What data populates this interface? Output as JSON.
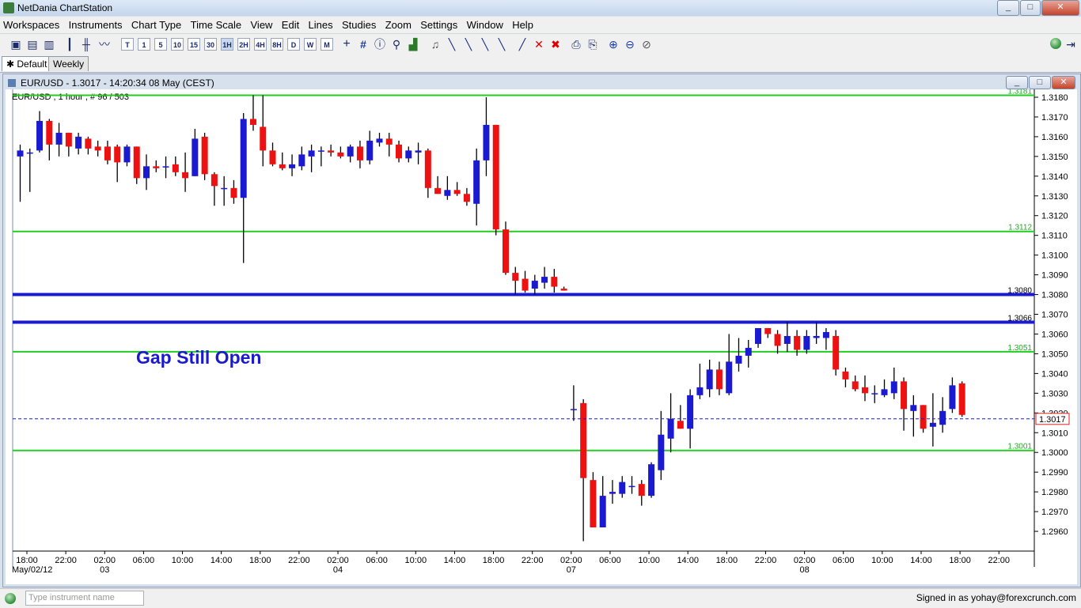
{
  "window": {
    "title": "NetDania ChartStation",
    "controls": [
      "_",
      "□",
      "✕"
    ]
  },
  "menu": [
    "Workspaces",
    "Instruments",
    "Chart Type",
    "Time Scale",
    "View",
    "Edit",
    "Lines",
    "Studies",
    "Zoom",
    "Settings",
    "Window",
    "Help"
  ],
  "toolbar": {
    "timescales": [
      "T",
      "1",
      "5",
      "10",
      "15",
      "30",
      "1H",
      "2H",
      "4H",
      "8H",
      "D",
      "W",
      "M"
    ],
    "icons": [
      "new-icon",
      "open-icon",
      "save-icon",
      "candles-icon",
      "bars-icon",
      "line-icon",
      "crosshair-icon",
      "grid-icon",
      "info-icon",
      "studies-icon",
      "alert-icon",
      "draw-tools-icon",
      "delete-icon",
      "delete-all-icon",
      "print-icon",
      "print-preview-icon",
      "zoom-in-icon",
      "zoom-out-icon",
      "zoom-reset-icon",
      "connection-icon",
      "pin-icon"
    ]
  },
  "tabs": [
    {
      "label": "Default",
      "active": true
    },
    {
      "label": "Weekly",
      "active": false
    }
  ],
  "chart_window": {
    "title": "EUR/USD - 1.3017 - 14:20:34  08 May (CEST)",
    "controls": [
      "_",
      "□",
      "✕"
    ]
  },
  "chart_data": {
    "type": "candlestick",
    "instrument_label": "EUR/USD , 1 hour , # 96 / 503",
    "annotation": "Gap Still Open",
    "ylim": [
      1.295,
      1.3184
    ],
    "y_ticks": [
      "1.2960",
      "1.2970",
      "1.2980",
      "1.2990",
      "1.3000",
      "1.3010",
      "1.3020",
      "1.3030",
      "1.3040",
      "1.3050",
      "1.3060",
      "1.3070",
      "1.3080",
      "1.3090",
      "1.3100",
      "1.3110",
      "1.3120",
      "1.3130",
      "1.3140",
      "1.3150",
      "1.3160",
      "1.3170",
      "1.3180"
    ],
    "x_ticks": [
      {
        "label": "18:00",
        "date": "May/02/12"
      },
      {
        "label": "22:00",
        "date": ""
      },
      {
        "label": "02:00",
        "date": "03"
      },
      {
        "label": "06:00",
        "date": ""
      },
      {
        "label": "10:00",
        "date": ""
      },
      {
        "label": "14:00",
        "date": ""
      },
      {
        "label": "18:00",
        "date": ""
      },
      {
        "label": "22:00",
        "date": ""
      },
      {
        "label": "02:00",
        "date": "04"
      },
      {
        "label": "06:00",
        "date": ""
      },
      {
        "label": "10:00",
        "date": ""
      },
      {
        "label": "14:00",
        "date": ""
      },
      {
        "label": "18:00",
        "date": ""
      },
      {
        "label": "22:00",
        "date": ""
      },
      {
        "label": "02:00",
        "date": "07"
      },
      {
        "label": "06:00",
        "date": ""
      },
      {
        "label": "10:00",
        "date": ""
      },
      {
        "label": "14:00",
        "date": ""
      },
      {
        "label": "18:00",
        "date": ""
      },
      {
        "label": "22:00",
        "date": ""
      },
      {
        "label": "02:00",
        "date": "08"
      },
      {
        "label": "06:00",
        "date": ""
      },
      {
        "label": "10:00",
        "date": ""
      },
      {
        "label": "14:00",
        "date": ""
      },
      {
        "label": "18:00",
        "date": ""
      },
      {
        "label": "22:00",
        "date": ""
      }
    ],
    "current_price": "1.3017",
    "levels": [
      {
        "label": "1.3181",
        "value": 1.3181,
        "color": "#22cc22",
        "type": "green"
      },
      {
        "label": "1.3112",
        "value": 1.3112,
        "color": "#22cc22",
        "type": "green"
      },
      {
        "label": "1.3080",
        "value": 1.308,
        "color": "#1a1ad0",
        "type": "blue"
      },
      {
        "label": "1.3066",
        "value": 1.3066,
        "color": "#1a1ad0",
        "type": "blue"
      },
      {
        "label": "1.3051",
        "value": 1.3051,
        "color": "#22cc22",
        "type": "green"
      },
      {
        "label": "1.3001",
        "value": 1.3001,
        "color": "#22cc22",
        "type": "green"
      }
    ],
    "colors": {
      "up": "#1a1ad0",
      "down": "#ee1111",
      "wick": "#000000",
      "current": "#1a1ad0",
      "annotation": "#1a1ad0"
    },
    "segments": [
      {
        "start_slot": 0,
        "candles": [
          [
            1.315,
            1.3156,
            1.3127,
            1.3153
          ],
          [
            1.3152,
            1.3154,
            1.3132,
            1.3152
          ],
          [
            1.3153,
            1.3173,
            1.3152,
            1.3168
          ],
          [
            1.3168,
            1.3169,
            1.3148,
            1.3156
          ],
          [
            1.3156,
            1.3167,
            1.315,
            1.3162
          ],
          [
            1.3162,
            1.3162,
            1.315,
            1.3155
          ],
          [
            1.3154,
            1.3162,
            1.3151,
            1.316
          ],
          [
            1.3159,
            1.316,
            1.3151,
            1.3154
          ],
          [
            1.3155,
            1.3158,
            1.315,
            1.3153
          ],
          [
            1.3155,
            1.3158,
            1.3146,
            1.3148
          ],
          [
            1.3155,
            1.3156,
            1.3137,
            1.3147
          ],
          [
            1.3147,
            1.3156,
            1.3145,
            1.3155
          ],
          [
            1.3155,
            1.3155,
            1.3136,
            1.3139
          ],
          [
            1.3139,
            1.3151,
            1.3133,
            1.3145
          ],
          [
            1.3145,
            1.3148,
            1.3142,
            1.3144
          ],
          [
            1.3145,
            1.315,
            1.3139,
            1.3145
          ],
          [
            1.3146,
            1.315,
            1.314,
            1.3142
          ],
          [
            1.3142,
            1.3152,
            1.3132,
            1.3139
          ],
          [
            1.314,
            1.3164,
            1.314,
            1.3159
          ],
          [
            1.316,
            1.3162,
            1.3138,
            1.3141
          ],
          [
            1.3141,
            1.3142,
            1.3125,
            1.3135
          ],
          [
            1.3134,
            1.314,
            1.3125,
            1.3134
          ],
          [
            1.3134,
            1.3138,
            1.3126,
            1.3129
          ],
          [
            1.3129,
            1.3172,
            1.3096,
            1.3169
          ],
          [
            1.3169,
            1.3181,
            1.3163,
            1.3166
          ],
          [
            1.3165,
            1.3181,
            1.3145,
            1.3153
          ],
          [
            1.3153,
            1.3157,
            1.3145,
            1.3146
          ],
          [
            1.3146,
            1.3152,
            1.3143,
            1.3144
          ],
          [
            1.3144,
            1.3151,
            1.314,
            1.3146
          ],
          [
            1.3145,
            1.3155,
            1.3143,
            1.3151
          ],
          [
            1.315,
            1.3156,
            1.3142,
            1.3153
          ],
          [
            1.3153,
            1.3155,
            1.3145,
            1.3153
          ],
          [
            1.3153,
            1.3156,
            1.315,
            1.3152
          ],
          [
            1.3152,
            1.3155,
            1.3149,
            1.315
          ],
          [
            1.315,
            1.3156,
            1.3147,
            1.3155
          ],
          [
            1.3155,
            1.3158,
            1.3144,
            1.3148
          ],
          [
            1.3148,
            1.3163,
            1.3146,
            1.3158
          ],
          [
            1.3157,
            1.3162,
            1.3155,
            1.3159
          ],
          [
            1.3159,
            1.3162,
            1.315,
            1.3156
          ],
          [
            1.3156,
            1.3158,
            1.3147,
            1.3149
          ],
          [
            1.3149,
            1.3155,
            1.3147,
            1.3153
          ],
          [
            1.3152,
            1.3157,
            1.3146,
            1.3153
          ],
          [
            1.3153,
            1.3154,
            1.3129,
            1.3134
          ],
          [
            1.3134,
            1.314,
            1.3131,
            1.3131
          ],
          [
            1.313,
            1.314,
            1.3128,
            1.3133
          ],
          [
            1.3133,
            1.3137,
            1.313,
            1.3131
          ],
          [
            1.3131,
            1.3134,
            1.3125,
            1.3127
          ],
          [
            1.3126,
            1.3154,
            1.3115,
            1.3148
          ],
          [
            1.3148,
            1.318,
            1.314,
            1.3166
          ],
          [
            1.3166,
            1.3166,
            1.311,
            1.3113
          ],
          [
            1.3113,
            1.3117,
            1.309,
            1.3091
          ],
          [
            1.3091,
            1.3094,
            1.308,
            1.3087
          ],
          [
            1.3088,
            1.3092,
            1.3081,
            1.3082
          ],
          [
            1.3083,
            1.309,
            1.308,
            1.3087
          ],
          [
            1.3086,
            1.3094,
            1.3083,
            1.3089
          ],
          [
            1.3089,
            1.3093,
            1.3081,
            1.3084
          ],
          [
            1.3083,
            1.3084,
            1.3082,
            1.3082
          ]
        ]
      },
      {
        "start_slot": 57,
        "candles": [
          [
            1.3022,
            1.3034,
            1.3016,
            1.3022
          ]
        ]
      },
      {
        "start_slot": 58,
        "candles": [
          [
            1.3025,
            1.3027,
            1.2955,
            1.2987
          ],
          [
            1.2986,
            1.299,
            1.2962,
            1.2962
          ],
          [
            1.2962,
            1.2988,
            1.2962,
            1.2978
          ],
          [
            1.2979,
            1.2986,
            1.2974,
            1.298
          ],
          [
            1.2979,
            1.2988,
            1.2977,
            1.2985
          ],
          [
            1.2983,
            1.2988,
            1.2979,
            1.2983
          ],
          [
            1.2984,
            1.2986,
            1.2973,
            1.2978
          ],
          [
            1.2978,
            1.2995,
            1.2977,
            1.2994
          ],
          [
            1.2991,
            1.3021,
            1.2986,
            1.3009
          ],
          [
            1.3007,
            1.303,
            1.3,
            1.3017
          ],
          [
            1.3016,
            1.3024,
            1.3012,
            1.3012
          ],
          [
            1.3012,
            1.3032,
            1.3002,
            1.3029
          ],
          [
            1.3029,
            1.3045,
            1.3027,
            1.3033
          ],
          [
            1.3032,
            1.3047,
            1.3028,
            1.3042
          ],
          [
            1.3042,
            1.3046,
            1.3029,
            1.3032
          ],
          [
            1.303,
            1.306,
            1.3029,
            1.3046
          ],
          [
            1.3045,
            1.3058,
            1.3041,
            1.3049
          ],
          [
            1.3049,
            1.3057,
            1.3043,
            1.3053
          ],
          [
            1.3055,
            1.3063,
            1.3053,
            1.3063
          ],
          [
            1.3063,
            1.3063,
            1.3058,
            1.306
          ],
          [
            1.306,
            1.3062,
            1.305,
            1.3054
          ],
          [
            1.3055,
            1.3066,
            1.3051,
            1.3059
          ],
          [
            1.3059,
            1.3062,
            1.3049,
            1.3052
          ],
          [
            1.3052,
            1.3062,
            1.305,
            1.3059
          ],
          [
            1.3058,
            1.3066,
            1.3055,
            1.3059
          ],
          [
            1.3058,
            1.3063,
            1.3052,
            1.3061
          ],
          [
            1.3059,
            1.3062,
            1.3039,
            1.3042
          ],
          [
            1.3041,
            1.3043,
            1.3033,
            1.3037
          ],
          [
            1.3036,
            1.3039,
            1.3031,
            1.3032
          ],
          [
            1.3033,
            1.3039,
            1.3026,
            1.303
          ],
          [
            1.303,
            1.3034,
            1.3025,
            1.303
          ],
          [
            1.3029,
            1.3037,
            1.3028,
            1.3032
          ],
          [
            1.303,
            1.3043,
            1.3027,
            1.3036
          ],
          [
            1.3036,
            1.3038,
            1.3011,
            1.3022
          ],
          [
            1.3021,
            1.3029,
            1.3008,
            1.3024
          ],
          [
            1.3024,
            1.3024,
            1.301,
            1.3012
          ],
          [
            1.3013,
            1.303,
            1.3003,
            1.3015
          ],
          [
            1.3014,
            1.3028,
            1.301,
            1.3021
          ],
          [
            1.3022,
            1.3038,
            1.302,
            1.3034
          ],
          [
            1.3035,
            1.3036,
            1.3018,
            1.3019
          ]
        ]
      }
    ]
  },
  "statusbar": {
    "search_placeholder": "Type instrument name",
    "signed_in": "Signed in as yohay@forexcrunch.com"
  }
}
